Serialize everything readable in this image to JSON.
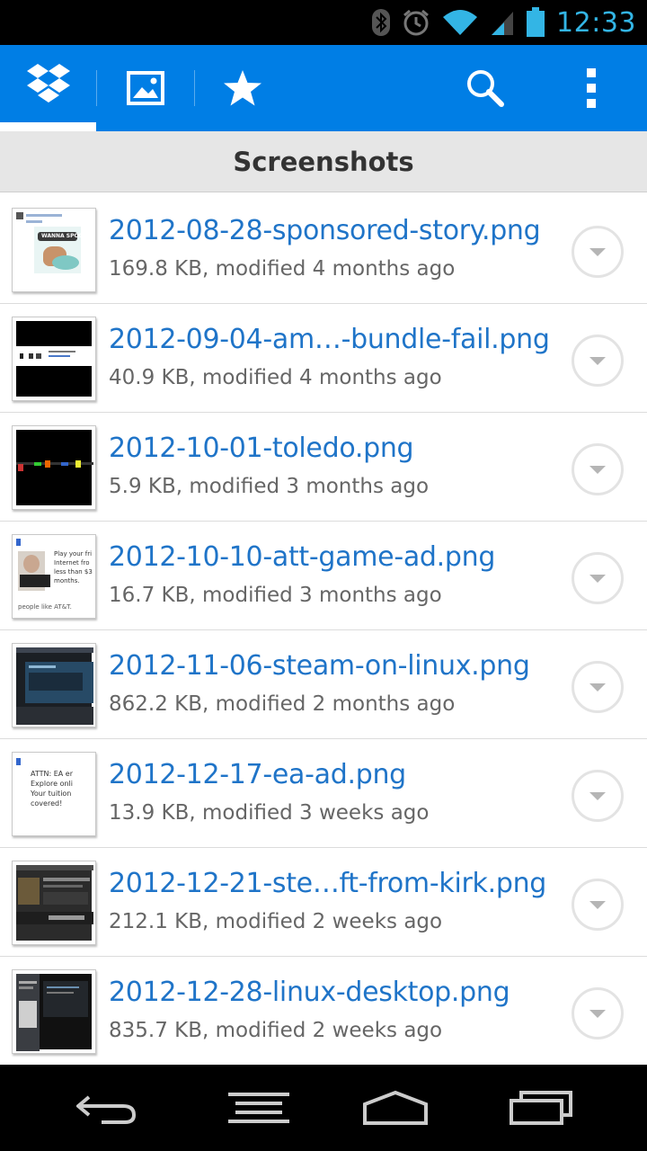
{
  "status_bar": {
    "time": "12:33",
    "icons": [
      "bluetooth-icon",
      "alarm-icon",
      "wifi-icon",
      "signal-icon",
      "battery-icon"
    ],
    "accent_color": "#33b5e5"
  },
  "action_bar": {
    "color": "#007ee5",
    "tabs": [
      {
        "icon": "dropbox-icon",
        "active": true
      },
      {
        "icon": "photos-icon",
        "active": false
      },
      {
        "icon": "favorites-star-icon",
        "active": false
      }
    ],
    "actions": [
      "search-icon",
      "overflow-menu-icon"
    ]
  },
  "header": {
    "title": "Screenshots"
  },
  "files": [
    {
      "name": "2012-08-28-sponsored-story.png",
      "meta": "169.8 KB, modified 4 months ago"
    },
    {
      "name": "2012-09-04-am…-bundle-fail.png",
      "meta": "40.9 KB, modified 4 months ago"
    },
    {
      "name": "2012-10-01-toledo.png",
      "meta": "5.9 KB, modified 3 months ago"
    },
    {
      "name": "2012-10-10-att-game-ad.png",
      "meta": "16.7 KB, modified 3 months ago"
    },
    {
      "name": "2012-11-06-steam-on-linux.png",
      "meta": "862.2 KB, modified 2 months ago"
    },
    {
      "name": "2012-12-17-ea-ad.png",
      "meta": "13.9 KB, modified 3 weeks ago"
    },
    {
      "name": "2012-12-21-ste…ft-from-kirk.png",
      "meta": "212.1 KB, modified 2 weeks ago"
    },
    {
      "name": "2012-12-28-linux-desktop.png",
      "meta": "835.7 KB, modified 2 weeks ago"
    }
  ],
  "thumb_text": {
    "sponsored_story": "WANNA SPOON?",
    "att_ad": [
      "Play your fri",
      "Internet fro",
      "less than $3",
      "months."
    ],
    "att_ad_footer": "people like AT&T.",
    "ea_ad": [
      "ATTN: EA er",
      "Explore onli",
      "Your tuition",
      "covered!"
    ]
  },
  "nav_bar": {
    "buttons": [
      "back-icon",
      "menu-icon",
      "home-icon",
      "recent-apps-icon"
    ]
  }
}
